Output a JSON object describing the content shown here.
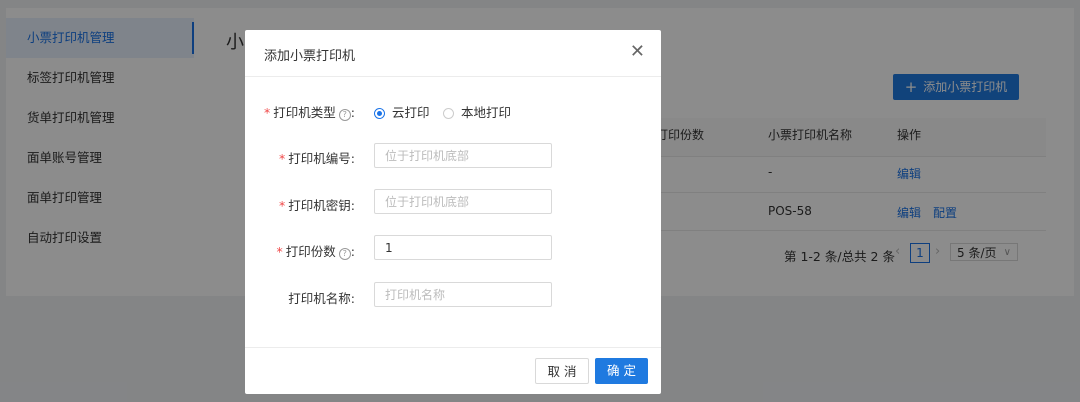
{
  "sidebar": {
    "items": [
      {
        "label": "小票打印机管理",
        "active": true
      },
      {
        "label": "标签打印机管理"
      },
      {
        "label": "货单打印机管理"
      },
      {
        "label": "面单账号管理"
      },
      {
        "label": "面单打印管理"
      },
      {
        "label": "自动打印设置"
      }
    ]
  },
  "page": {
    "title": "小",
    "add_button": "添加小票打印机",
    "table": {
      "headers": [
        "打印份数",
        "小票打印机名称",
        "操作"
      ],
      "rows": [
        {
          "name": "-",
          "actions": [
            "编辑"
          ]
        },
        {
          "name": "POS-58",
          "actions": [
            "编辑",
            "配置"
          ]
        }
      ]
    },
    "pagination": {
      "summary": "第 1-2 条/总共 2 条",
      "current": "1",
      "page_size": "5 条/页"
    }
  },
  "modal": {
    "title": "添加小票打印机",
    "fields": {
      "type": {
        "label": "打印机类型",
        "options": [
          "云打印",
          "本地打印"
        ],
        "selected": "云打印"
      },
      "number": {
        "label": "打印机编号:",
        "placeholder": "位于打印机底部",
        "value": ""
      },
      "key": {
        "label": "打印机密钥:",
        "placeholder": "位于打印机底部",
        "value": ""
      },
      "copies": {
        "label": "打印份数",
        "value": "1"
      },
      "name": {
        "label": "打印机名称:",
        "placeholder": "打印机名称",
        "value": ""
      }
    },
    "cancel": "取 消",
    "ok": "确 定"
  },
  "colors": {
    "accent": "#1f7ae0",
    "required": "#f04848"
  }
}
